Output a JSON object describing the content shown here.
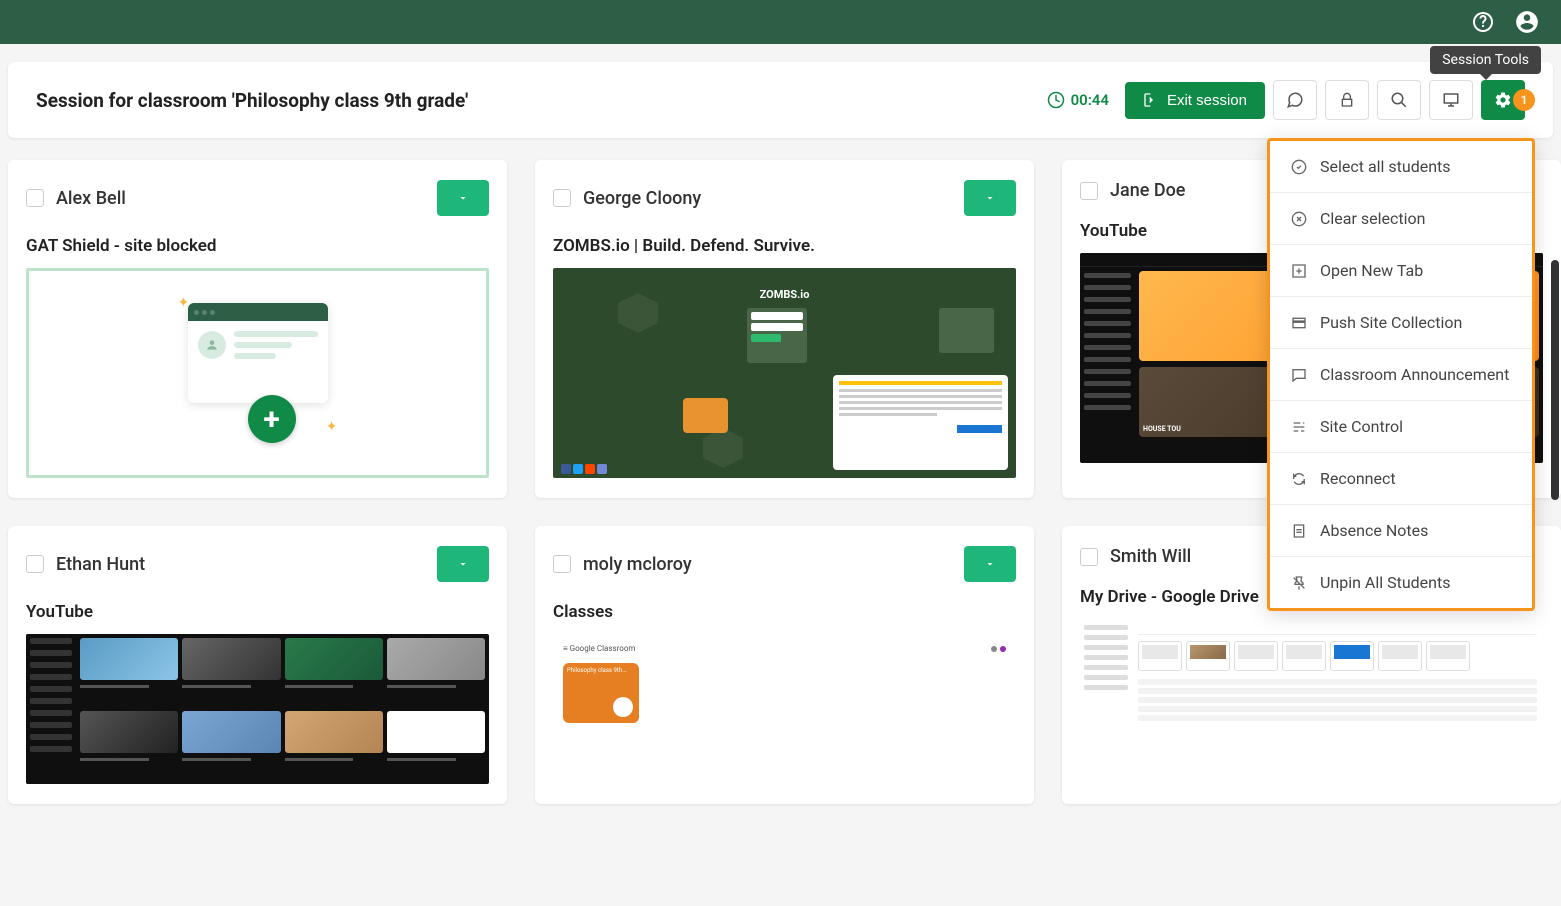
{
  "tooltip": "Session Tools",
  "session": {
    "title": "Session for classroom 'Philosophy class 9th grade'",
    "timer": "00:44",
    "exit_label": "Exit session",
    "badge_count": "1"
  },
  "students": [
    {
      "name": "Alex Bell",
      "tab": "GAT Shield - site blocked"
    },
    {
      "name": "George Cloony",
      "tab": "ZOMBS.io | Build. Defend. Survive."
    },
    {
      "name": "Jane Doe",
      "tab": "YouTube"
    },
    {
      "name": "Ethan Hunt",
      "tab": "YouTube"
    },
    {
      "name": "moly mcloroy",
      "tab": "Classes"
    },
    {
      "name": "Smith Will",
      "tab": "My Drive - Google Drive"
    }
  ],
  "menu": {
    "select_all": "Select all students",
    "clear_selection": "Clear selection",
    "open_new_tab": "Open New Tab",
    "push_site": "Push Site Collection",
    "announcement": "Classroom Announcement",
    "site_control": "Site Control",
    "reconnect": "Reconnect",
    "absence_notes": "Absence Notes",
    "unpin_all": "Unpin All Students"
  },
  "game": {
    "logo": "ZOMBS.io"
  }
}
